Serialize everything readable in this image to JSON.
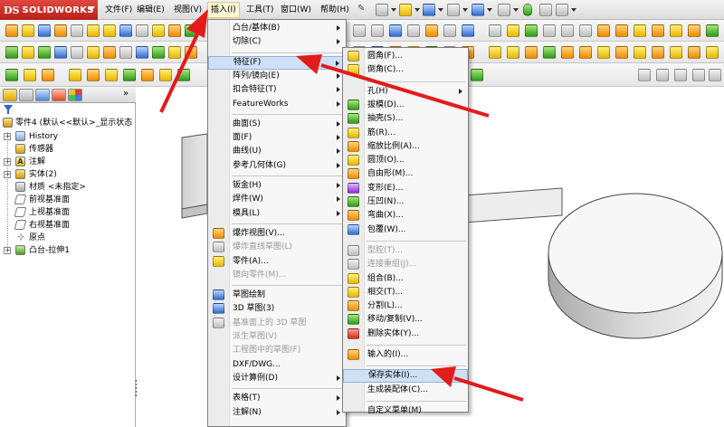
{
  "app": {
    "brand_mark": "DS",
    "brand_name": "SOLIDWORKS"
  },
  "menubar": {
    "items": [
      {
        "label": "文件(F)"
      },
      {
        "label": "编辑(E)"
      },
      {
        "label": "视图(V)"
      },
      {
        "label": "插入(I)",
        "active": true
      },
      {
        "label": "工具(T)"
      },
      {
        "label": "窗口(W)"
      },
      {
        "label": "帮助(H)"
      }
    ]
  },
  "feature_tree": {
    "root": "零件4 (默认<<默认>_显示状态",
    "items": [
      {
        "label": "History",
        "icon": "history-icon",
        "expandable": true
      },
      {
        "label": "传感器",
        "icon": "sensor-icon",
        "expandable": false
      },
      {
        "label": "注解",
        "icon": "annotation-icon",
        "expandable": true
      },
      {
        "label": "实体(2)",
        "icon": "solid-bodies-icon",
        "expandable": true
      },
      {
        "label": "材质 <未指定>",
        "icon": "material-icon",
        "expandable": false
      },
      {
        "label": "前视基准面",
        "icon": "plane-icon",
        "expandable": false
      },
      {
        "label": "上视基准面",
        "icon": "plane-icon",
        "expandable": false
      },
      {
        "label": "右视基准面",
        "icon": "plane-icon",
        "expandable": false
      },
      {
        "label": "原点",
        "icon": "origin-icon",
        "expandable": false
      },
      {
        "label": "凸台-拉伸1",
        "icon": "boss-extrude-icon",
        "expandable": true
      }
    ]
  },
  "insert_menu": {
    "items": [
      {
        "label": "凸台/基体(B)",
        "sub": true
      },
      {
        "label": "切除(C)",
        "sub": true
      },
      {
        "sep": true
      },
      {
        "label": "特征(F)",
        "sub": true,
        "highlight": true
      },
      {
        "label": "阵列/镜向(E)",
        "sub": true
      },
      {
        "label": "扣合特征(T)",
        "sub": true
      },
      {
        "label": "FeatureWorks",
        "sub": true
      },
      {
        "sep": true
      },
      {
        "label": "曲面(S)",
        "sub": true
      },
      {
        "label": "面(F)",
        "sub": true
      },
      {
        "label": "曲线(U)",
        "sub": true
      },
      {
        "label": "参考几何体(G)",
        "sub": true
      },
      {
        "sep": true
      },
      {
        "label": "钣金(H)",
        "sub": true
      },
      {
        "label": "焊件(W)",
        "sub": true
      },
      {
        "label": "模具(L)",
        "sub": true
      },
      {
        "sep": true
      },
      {
        "label": "爆炸视图(V)...",
        "icon": "o"
      },
      {
        "label": "爆炸直线草图(L)",
        "icon": "gr",
        "disabled": true
      },
      {
        "label": "零件(A)...",
        "icon": "y"
      },
      {
        "label": "镜向零件(M)...",
        "disabled": true
      },
      {
        "sep": true
      },
      {
        "label": "草图绘制",
        "icon": "b"
      },
      {
        "label": "3D 草图(3)",
        "icon": "b"
      },
      {
        "label": "基准面上的 3D 草图",
        "icon": "gr",
        "disabled": true
      },
      {
        "label": "派生草图(V)",
        "disabled": true
      },
      {
        "label": "工程图中的草图(F)",
        "disabled": true
      },
      {
        "label": "DXF/DWG..."
      },
      {
        "label": "设计算例(D)",
        "sub": true
      },
      {
        "sep": true
      },
      {
        "label": "表格(T)",
        "sub": true
      },
      {
        "label": "注解(N)",
        "sub": true
      }
    ]
  },
  "features_submenu": {
    "items": [
      {
        "label": "圆角(F)...",
        "icon": "y"
      },
      {
        "label": "倒角(C)...",
        "icon": "y"
      },
      {
        "sep": true
      },
      {
        "label": "孔(H)",
        "sub": true
      },
      {
        "label": "拔模(D)...",
        "icon": "g"
      },
      {
        "label": "抽壳(S)...",
        "icon": "g"
      },
      {
        "label": "筋(R)...",
        "icon": "y"
      },
      {
        "label": "缩放比例(A)...",
        "icon": "o"
      },
      {
        "label": "圆顶(O)...",
        "icon": "y"
      },
      {
        "label": "自由形(M)...",
        "icon": "o"
      },
      {
        "label": "变形(E)...",
        "icon": "p"
      },
      {
        "label": "压凹(N)...",
        "icon": "g"
      },
      {
        "label": "弯曲(X)...",
        "icon": "o"
      },
      {
        "label": "包覆(W)...",
        "icon": "b"
      },
      {
        "sep": true
      },
      {
        "label": "型腔(T)...",
        "icon": "gr",
        "disabled": true
      },
      {
        "label": "连接重组(J)...",
        "icon": "gr",
        "disabled": true
      },
      {
        "label": "组合(B)...",
        "icon": "y"
      },
      {
        "label": "相交(T)...",
        "icon": "y"
      },
      {
        "label": "分割(L)...",
        "icon": "o"
      },
      {
        "label": "移动/复制(V)...",
        "icon": "g"
      },
      {
        "label": "删除实体(Y)...",
        "icon": "r"
      },
      {
        "sep": true
      },
      {
        "label": "输入的(I)...",
        "icon": "o"
      },
      {
        "sep": true
      },
      {
        "label": "保存实体(I)...",
        "highlight": true
      },
      {
        "label": "生成装配体(C)..."
      },
      {
        "sep": true
      },
      {
        "label": "自定义菜单(M)"
      }
    ]
  },
  "colors": {
    "highlight": "#cfe0f5",
    "annotation_arrow": "#e31b1b",
    "brand": "#c8261f"
  }
}
